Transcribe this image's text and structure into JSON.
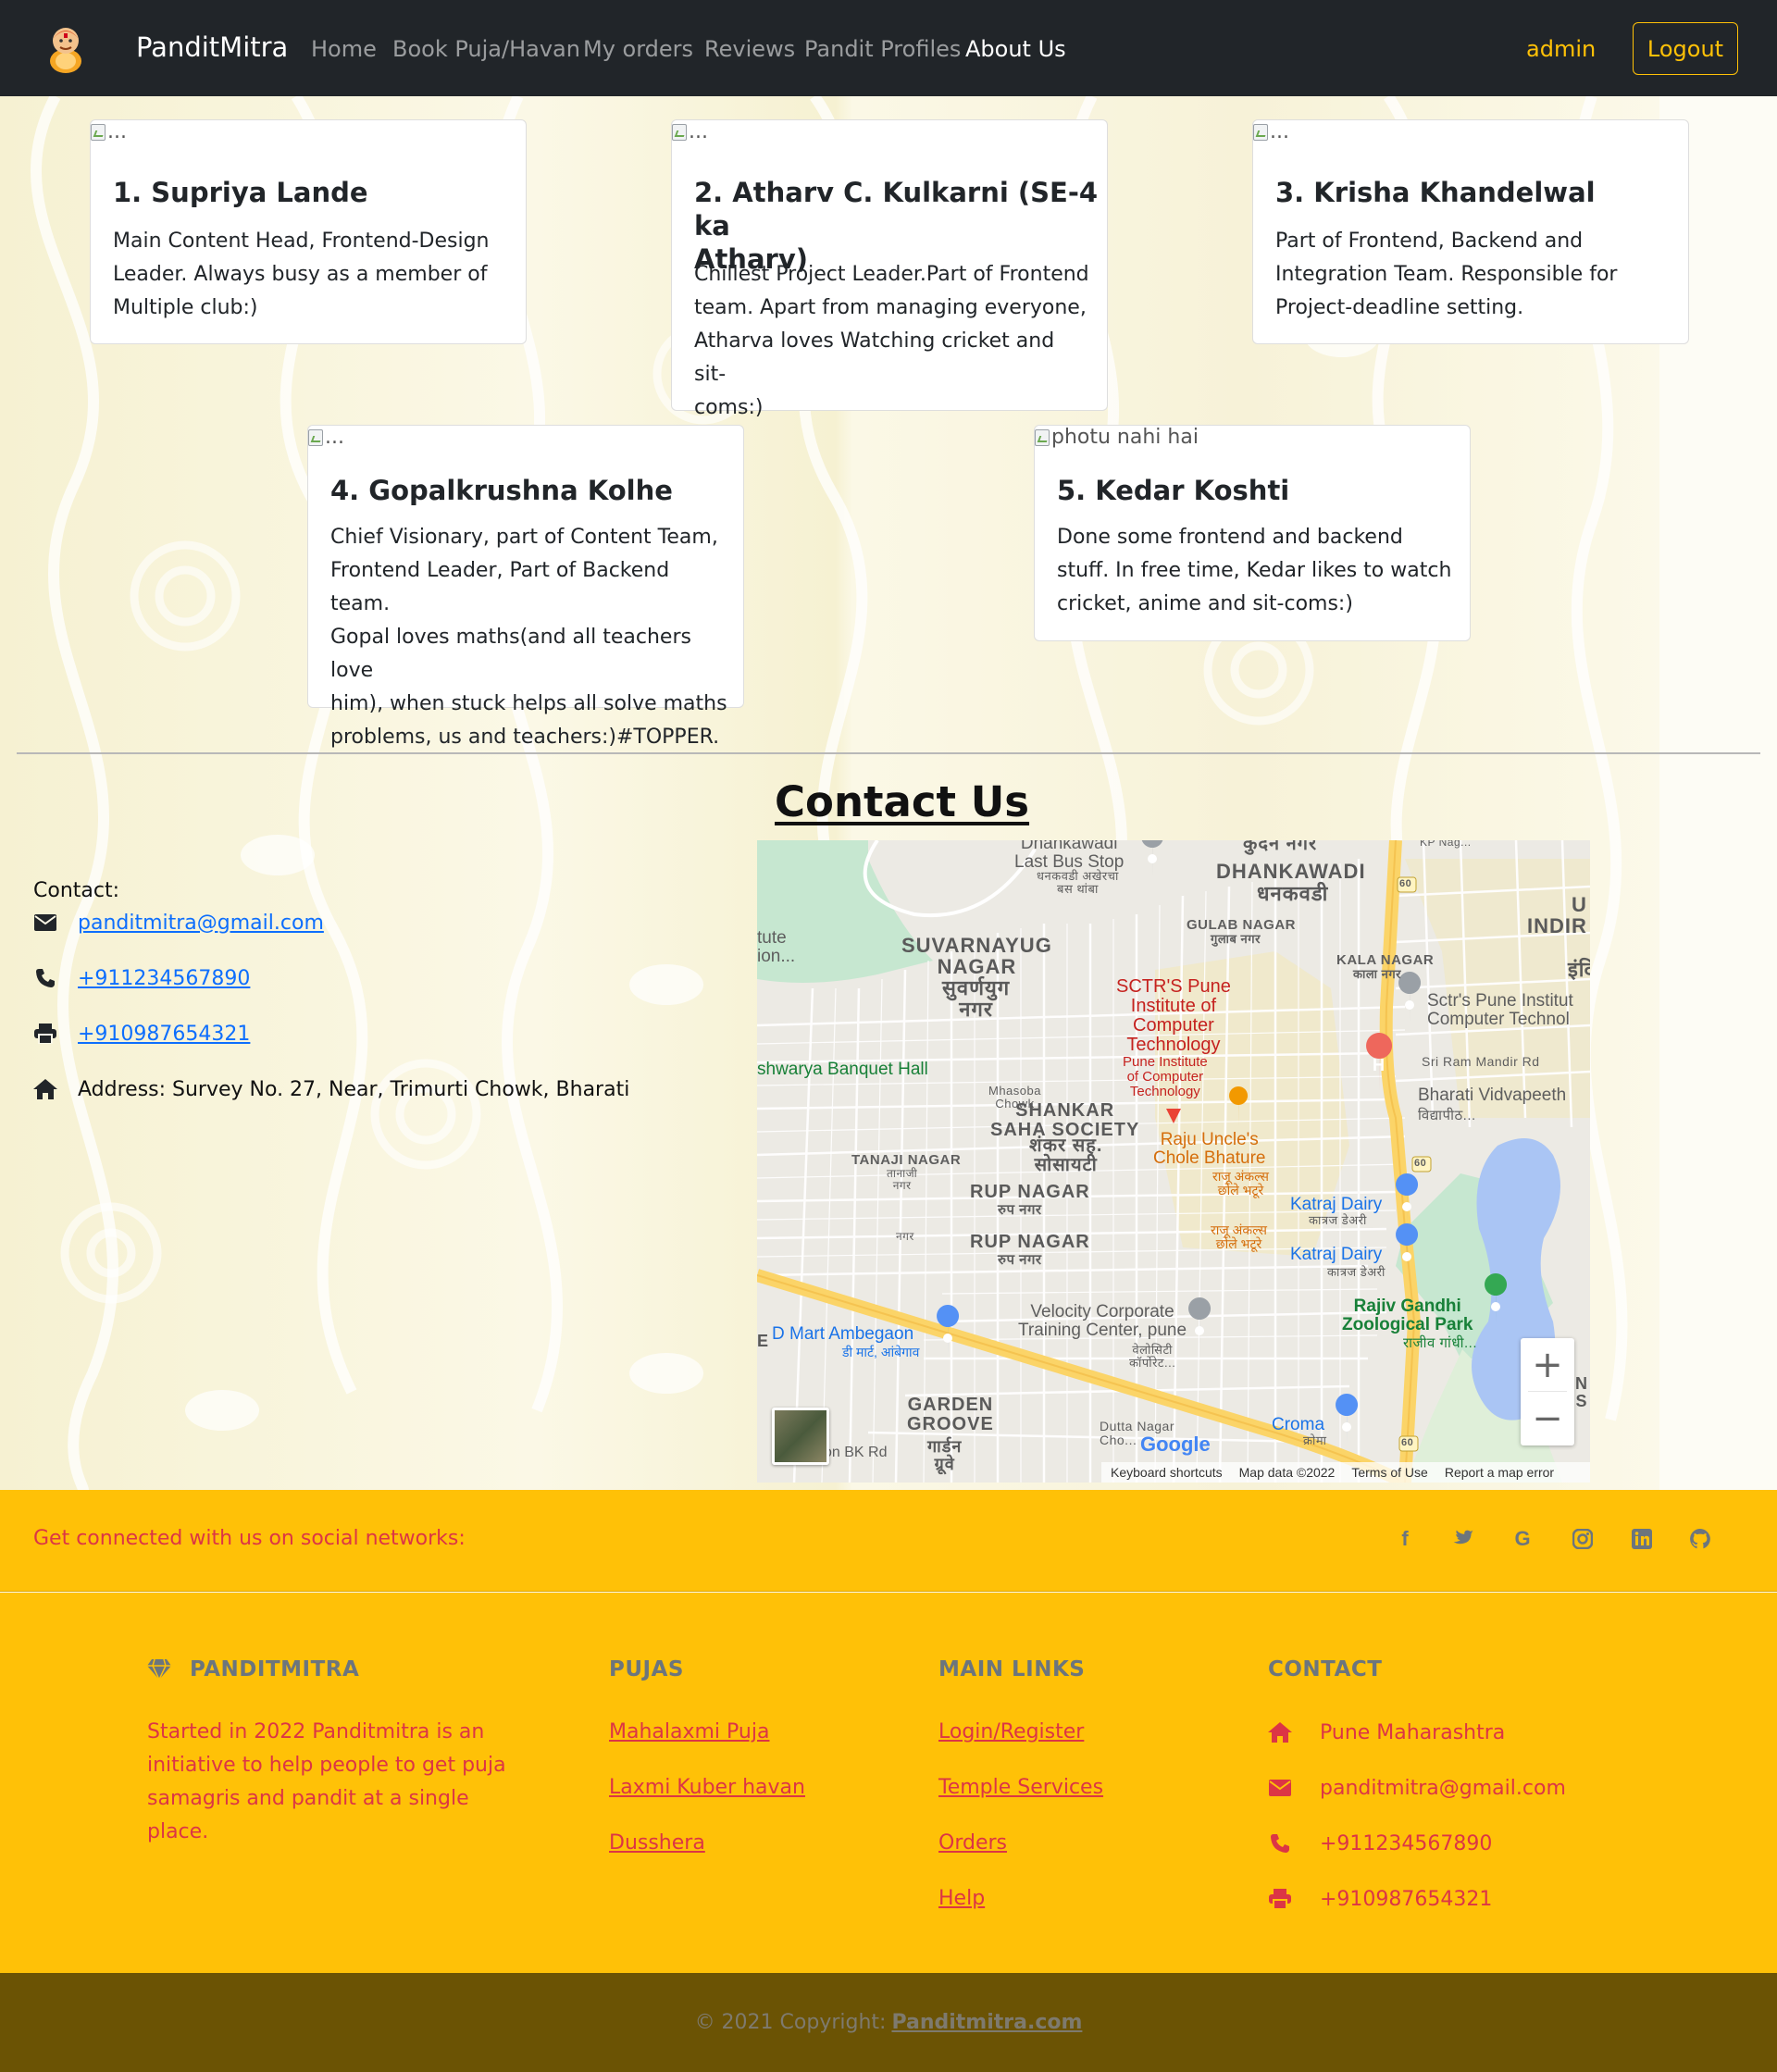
{
  "navbar": {
    "brand": "PanditMitra",
    "links": [
      "Home",
      "Book Puja/Havan",
      "My orders",
      "Reviews",
      "Pandit Profiles",
      "About Us"
    ],
    "active_link": "About Us",
    "user": "admin",
    "logout": "Logout"
  },
  "members": [
    {
      "img_alt": "...",
      "title": "1. Supriya Lande",
      "lines": [
        "Main Content Head, Frontend-Design",
        "Leader. Always busy as a member of",
        "Multiple club:)"
      ]
    },
    {
      "img_alt": "...",
      "title_lines": [
        "2. Atharv C. Kulkarni (SE-4 ka",
        "Atharv)"
      ],
      "lines": [
        "Chillest Project Leader.Part of Frontend",
        "team. Apart from managing everyone,",
        "Atharva loves Watching cricket and sit-",
        "coms:)"
      ]
    },
    {
      "img_alt": "...",
      "title": "3. Krisha Khandelwal",
      "lines": [
        "Part of Frontend, Backend and",
        "Integration Team. Responsible for",
        "Project-deadline setting."
      ]
    },
    {
      "img_alt": "...",
      "title": "4. Gopalkrushna Kolhe",
      "lines": [
        "Chief Visionary, part of Content Team,",
        "Frontend Leader, Part of Backend team.",
        "Gopal loves maths(and all teachers love",
        "him), when stuck helps all solve maths",
        "problems, us and teachers:)#TOPPER."
      ]
    },
    {
      "img_alt": "photu nahi hai",
      "title": "5. Kedar Koshti",
      "lines": [
        "Done some frontend and backend",
        "stuff. In free time, Kedar likes to watch",
        "cricket, anime and sit-coms:)"
      ]
    }
  ],
  "contact": {
    "heading": "Contact Us",
    "label": "Contact:",
    "email": "panditmitra@gmail.com",
    "phone": "+911234567890",
    "fax": "+910987654321",
    "address": "Address: Survey No. 27, Near, Trimurti Chowk, Bharati"
  },
  "map": {
    "labels": {
      "dhankawadi_stop": "Dhankawadi\nLast Bus Stop",
      "dhankawadi_stop_mr": "धनकवडी अखेरचा\nबस थांबा",
      "kudan": "कुदन नगर",
      "dhankawadi": "DHANKAWADI",
      "dhankawadi_mr": "धनकवडी",
      "kp_nagar": "KP Nag...",
      "indir": "U\nINDIR",
      "indir_mr": "इंदि",
      "tute": "tute\nion...",
      "suvarnayug": "SUVARNAYUG\nNAGAR",
      "suvarnayug_mr": "सुवर्णयुग\nनगर",
      "gulab": "GULAB NAGAR",
      "gulab_mr": "गुलाब नगर",
      "kala": "KALA NAGAR",
      "kala_mr": "काला नगर",
      "sctr_red": "SCTR'S Pune\nInstitute of\nComputer\nTechnology",
      "sctr_red_s": "Pune Institute\nof Computer\nTechnology",
      "sctr_blue": "Sctr's Pune Institut\nComputer Technol",
      "sri_ram": "Sri Ram Mandir Rd",
      "bharati": "Bharati Vidvapeeth",
      "bharati_mr": "विद्यापीठ...",
      "aishwarya": "shwarya Banquet Hall",
      "mhasoba": "Mhasoba\nChowk",
      "shankar": "SHANKAR\nSAHA SOCIETY",
      "shankar_mr": "शंकर सह.\nसोसायटी",
      "raju": "Raju Uncle's\nChole Bhature",
      "raju_mr": "राजू अंकल्स\nछोले भटूरे",
      "raju_mr2": "राजू अंकल्स\nछोले भटूरे",
      "tanaji": "TANAJI NAGAR",
      "tanaji_mr": "तानाजी\nनगर",
      "rup1": "RUP NAGAR",
      "rup1_mr": "रुप नगर",
      "rup2": "RUP NAGAR",
      "rup2_mr": "रुप नगर",
      "small_nagar": "नगर",
      "katraj1": "Katraj Dairy",
      "katraj1_mr": "कात्रज डेअरी",
      "katraj2": "Katraj Dairy",
      "katraj2_mr": "कात्रज डेअरी",
      "rajiv": "Rajiv Gandhi\nZoological Park",
      "rajiv_mr": "राजीव गांधी...",
      "velocity": "Velocity Corporate\nTraining Center, pune",
      "velocity_mr": "वेलोसिटी\nकॉर्पोरेट...",
      "dmart": "D Mart Ambegaon",
      "dmart_mr": "डी मार्ट, आंबेगाव",
      "e_letter": "E",
      "garden": "GARDEN\nGROOVE",
      "garden_mr": "गार्डन\nग्रूवे",
      "bk_rd": "on BK Rd",
      "dutta": "Dutta Nagar\nCho...",
      "croma": "Croma",
      "croma_mr": "क्रोमा",
      "n_letters": "N\nS",
      "route60": "60",
      "hospital": "H"
    },
    "zoom_in": "+",
    "zoom_out": "−",
    "google": "Google",
    "footer_links": [
      "Keyboard shortcuts",
      "Map data ©2022",
      "Terms of Use",
      "Report a map error"
    ]
  },
  "social": {
    "text": "Get connected with us on social networks:",
    "icons": [
      "facebook-icon",
      "twitter-icon",
      "google-icon",
      "instagram-icon",
      "linkedin-icon",
      "github-icon"
    ]
  },
  "footer": {
    "brand_heading": "PANDITMITRA",
    "brand_text": [
      "Started in 2022 Panditmitra is an",
      "initiative to help people to get puja",
      "samagris and pandit at a single",
      "place."
    ],
    "pujas_heading": "PUJAS",
    "pujas": [
      "Mahalaxmi Puja",
      "Laxmi Kuber havan",
      "Dusshera"
    ],
    "links_heading": "MAIN LINKS",
    "links": [
      "Login/Register",
      "Temple Services",
      "Orders",
      "Help"
    ],
    "contact_heading": "CONTACT",
    "contact": [
      "Pune Maharashtra",
      "panditmitra@gmail.com",
      "+911234567890",
      "+910987654321"
    ]
  },
  "copyright": {
    "text": "© 2021 Copyright:",
    "link": "Panditmitra.com"
  },
  "colors": {
    "navbar_bg": "#212529",
    "accent_yellow": "#ffc107",
    "footer_red": "#dc3545",
    "link_blue": "#0d6efd",
    "copyright_bg": "#6b5304"
  }
}
